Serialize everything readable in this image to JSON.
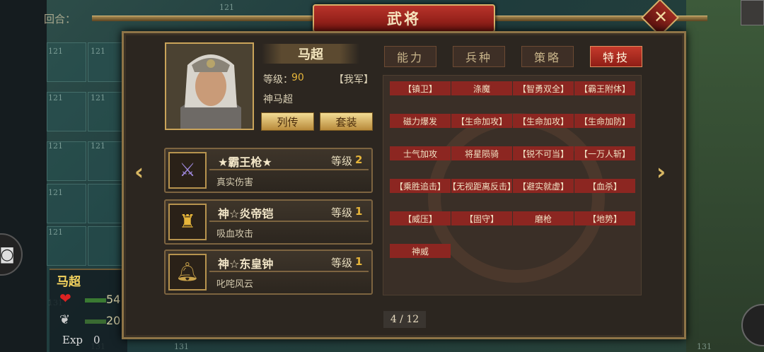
{
  "dialog": {
    "title": "武将"
  },
  "background": {
    "turn_label": "回合：",
    "tile_numbers": [
      "121",
      "121",
      "121",
      "121",
      "121",
      "121",
      "121",
      "121",
      "121",
      "131",
      "131",
      "131",
      "131"
    ],
    "unit": {
      "name": "马超",
      "hp": "54",
      "mp": "20",
      "exp_label": "Exp",
      "exp_value": "0"
    }
  },
  "general": {
    "name": "马超",
    "level_label": "等级：",
    "level": "90",
    "faction": "【我军】",
    "title": "神马超",
    "buttons": {
      "biography": "列传",
      "set": "套装"
    }
  },
  "equipment": [
    {
      "name": "★霸王枪★",
      "level_label": "等级",
      "level": "2",
      "desc": "真实伤害",
      "icon": "spear-icon"
    },
    {
      "name": "神☆炎帝铠",
      "level_label": "等级",
      "level": "1",
      "desc": "吸血攻击",
      "icon": "armor-icon"
    },
    {
      "name": "神☆东皇钟",
      "level_label": "等级",
      "level": "1",
      "desc": "叱咤风云",
      "icon": "bell-icon"
    }
  ],
  "tabs": [
    {
      "label": "能力",
      "active": false
    },
    {
      "label": "兵种",
      "active": false
    },
    {
      "label": "策略",
      "active": false
    },
    {
      "label": "特技",
      "active": true
    }
  ],
  "skills": [
    "【镇卫】",
    "涤魔",
    "【智勇双全】",
    "【霸王附体】",
    "磁力爆发",
    "【生命加攻】",
    "【生命加攻】",
    "【生命加防】",
    "士气加攻",
    "将星陨骑",
    "【锐不可当】",
    "【一万人斩】",
    "【乘胜追击】",
    "【无视距离反击】",
    "【避实就虚】",
    "【血杀】",
    "【威压】",
    "【固守】",
    "磨枪",
    "【地势】",
    "神威"
  ],
  "pagination": "4 / 12",
  "colors": {
    "accent_red": "#8c2621",
    "gold": "#e6b53a",
    "frame": "#8e7447"
  }
}
